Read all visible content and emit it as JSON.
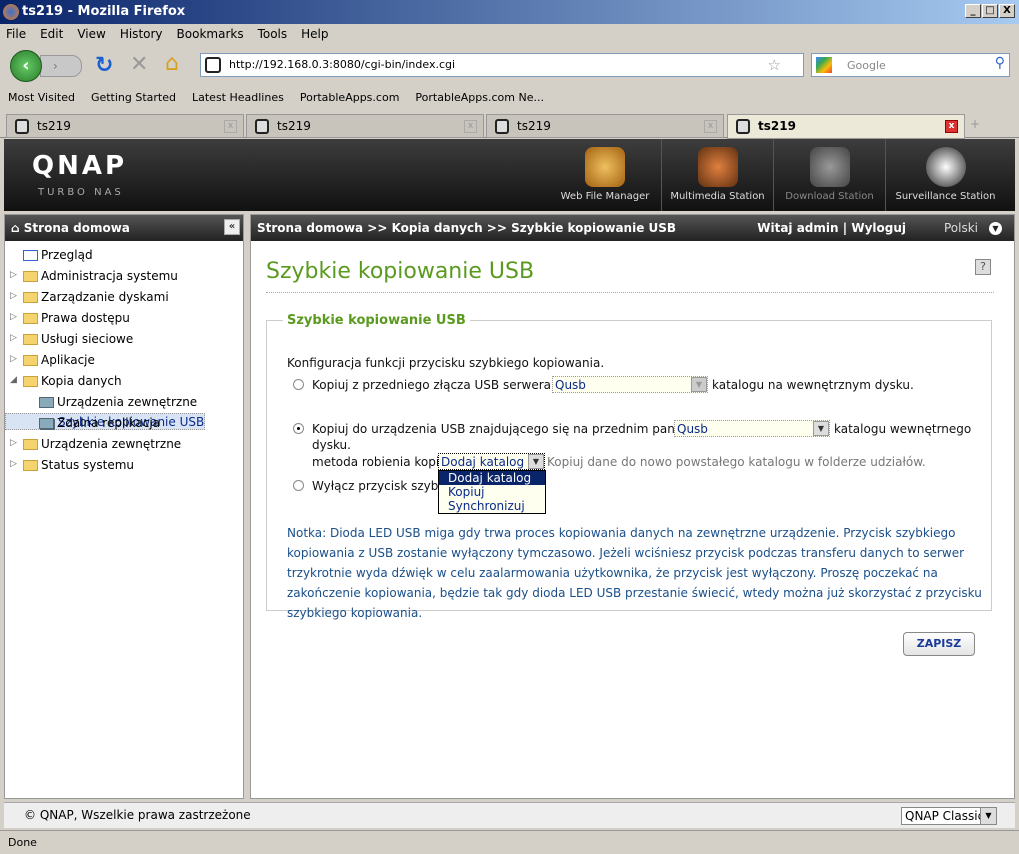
{
  "window": {
    "title": "ts219 - Mozilla Firefox"
  },
  "menu": [
    "File",
    "Edit",
    "View",
    "History",
    "Bookmarks",
    "Tools",
    "Help"
  ],
  "address": {
    "url": "http://192.168.0.3:8080/cgi-bin/index.cgi",
    "search_placeholder": "Google"
  },
  "bookmarks": [
    "Most Visited",
    "Getting Started",
    "Latest Headlines",
    "PortableApps.com",
    "PortableApps.com Ne..."
  ],
  "tabs": [
    {
      "label": "ts219"
    },
    {
      "label": "ts219"
    },
    {
      "label": "ts219"
    },
    {
      "label": "ts219",
      "active": true
    }
  ],
  "header": {
    "logo": "QNAP",
    "logo_sub": "TURBO NAS",
    "apps": [
      "Web File Manager",
      "Multimedia Station",
      "Download Station",
      "Surveillance Station"
    ]
  },
  "sidebar": {
    "title": "Strona domowa",
    "items": [
      {
        "label": "Przegląd"
      },
      {
        "label": "Administracja systemu"
      },
      {
        "label": "Zarządzanie dyskami"
      },
      {
        "label": "Prawa dostępu"
      },
      {
        "label": "Usługi sieciowe"
      },
      {
        "label": "Aplikacje"
      },
      {
        "label": "Kopia danych",
        "expanded": true
      },
      {
        "label": "Urządzenia zewnętrzne"
      },
      {
        "label": "Szybkie kopiowanie USB",
        "selected": true
      },
      {
        "label": "Zdalna replikacja"
      },
      {
        "label": "Urządzenia zewnętrzne"
      },
      {
        "label": "Status systemu"
      }
    ]
  },
  "breadcrumb": "Strona domowa >> Kopia danych >> Szybkie kopiowanie USB",
  "user": {
    "welcome": "Witaj admin",
    "logout": "Wyloguj",
    "sep": "|",
    "language": "Polski"
  },
  "page": {
    "title": "Szybkie kopiowanie USB",
    "legend": "Szybkie kopiowanie USB",
    "intro": "Konfiguracja funkcji przycisku szybkiego kopiowania.",
    "opt1_before": "Kopiuj z przedniego złącza USB serwera do",
    "opt1_select": "Qusb",
    "opt1_after": "katalogu na wewnętrznym dysku.",
    "opt2_before": "Kopiuj do urządzenia USB znajdującego się na przednim panelu z",
    "opt2_select": "Qusb",
    "opt2_after": "katalogu wewnętrnego",
    "opt2_line2": "dysku.",
    "method_label": "metoda robienia kopii:",
    "method_value": "Dodaj katalog",
    "method_desc": "Kopiuj dane do nowo powstałego katalogu w folderze udziałów.",
    "method_options": [
      "Dodaj katalog",
      "Kopiuj",
      "Synchronizuj"
    ],
    "opt3": "Wyłącz przycisk szybkie",
    "note": "Notka: Dioda LED USB miga gdy trwa proces kopiowania danych na zewnętrzne urządzenie. Przycisk szybkiego kopiowania z USB zostanie wyłączony tymczasowo. Jeżeli wciśniesz przycisk podczas transferu danych to serwer trzykrotnie wyda dźwięk w celu zaalarmowania użytkownika, że przycisk jest wyłączony. Proszę poczekać na zakończenie kopiowania, będzie tak gdy dioda LED USB przestanie świecić, wtedy można już skorzystać z przycisku szybkiego kopiowania.",
    "save": "ZAPISZ"
  },
  "footer": {
    "copyright": "© QNAP, Wszelkie prawa zastrzeżone",
    "theme": "QNAP Classic"
  },
  "status": "Done"
}
